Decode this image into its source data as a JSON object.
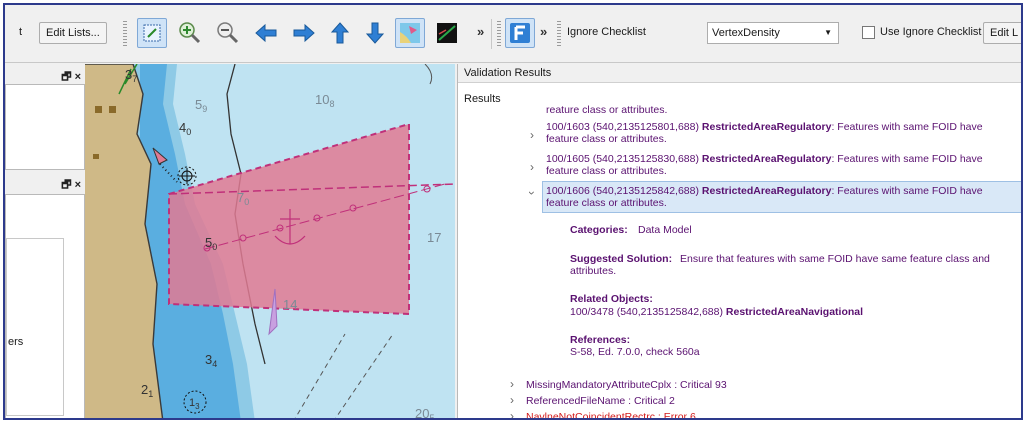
{
  "toolbar": {
    "truncated_label": "t",
    "edit_lists_label": "Edit Lists...",
    "overflow_chevron": "»",
    "fxy_chevron": "»",
    "ignore_checklist_label": "Ignore Checklist",
    "ignore_checklist_value": "VertexDensity",
    "use_ignore_checklist_label": "Use Ignore Checklist",
    "use_ignore_checklist_checked": false,
    "edit_truncated_label": "Edit L",
    "icons": [
      "select-box-icon",
      "zoom-in-icon",
      "zoom-out-icon",
      "pan-left-icon",
      "pan-right-icon",
      "pan-up-icon",
      "pan-down-icon",
      "s57-chart-icon",
      "night-mode-icon",
      "f-button-icon"
    ]
  },
  "left_panels": {
    "panel1_buttons": "🗗 ×",
    "panel2_buttons": "🗗 ×",
    "truncated_text": "ers"
  },
  "map": {
    "soundings": [
      "37",
      "59",
      "108",
      "40",
      "70",
      "50",
      "17",
      "14",
      "34",
      "21",
      "13",
      "205"
    ]
  },
  "results": {
    "panel_title": "Validation Results",
    "tree_root": "Results",
    "partial_line": "reature class or attributes.",
    "items": [
      {
        "id": "100/1603 (540,2135125801,688)",
        "type": "RestrictedAreaRegulatory",
        "msg": ": Features with same FOID have",
        "cont": "feature class or attributes.",
        "expanded": false
      },
      {
        "id": "100/1605 (540,2135125830,688)",
        "type": "RestrictedAreaRegulatory",
        "msg": ": Features with same FOID have",
        "cont": "feature class or attributes.",
        "expanded": false
      },
      {
        "id": "100/1606 (540,2135125842,688)",
        "type": "RestrictedAreaRegulatory",
        "msg": ": Features with same FOID have",
        "cont": "feature class or attributes.",
        "expanded": true
      }
    ],
    "details": {
      "categories_label": "Categories:",
      "categories_value": "Data Model",
      "solution_label": "Suggested Solution:",
      "solution_line1": "Ensure that features with same FOID have same feature class and",
      "solution_line2": "attributes.",
      "related_label": "Related Objects:",
      "related_id": "100/3478 (540,2135125842,688)",
      "related_type": "RestrictedAreaNavigational",
      "references_label": "References:",
      "references_value": "S-58, Ed. 7.0.0, check 560a"
    },
    "categories": [
      {
        "label": "MissingMandatoryAttributeCplx : Critical 93",
        "color": "#5a1170"
      },
      {
        "label": "ReferencedFileName : Critical 2",
        "color": "#5a1170"
      },
      {
        "label": "NavlneNotCoincidentRectrc : Error 6",
        "color": "#d21a1a"
      }
    ]
  },
  "colors": {
    "accent_blue": "#2d3a8c",
    "text_purple": "#5a1170",
    "error_red": "#d21a1a",
    "restricted_area": "#e07a93"
  }
}
